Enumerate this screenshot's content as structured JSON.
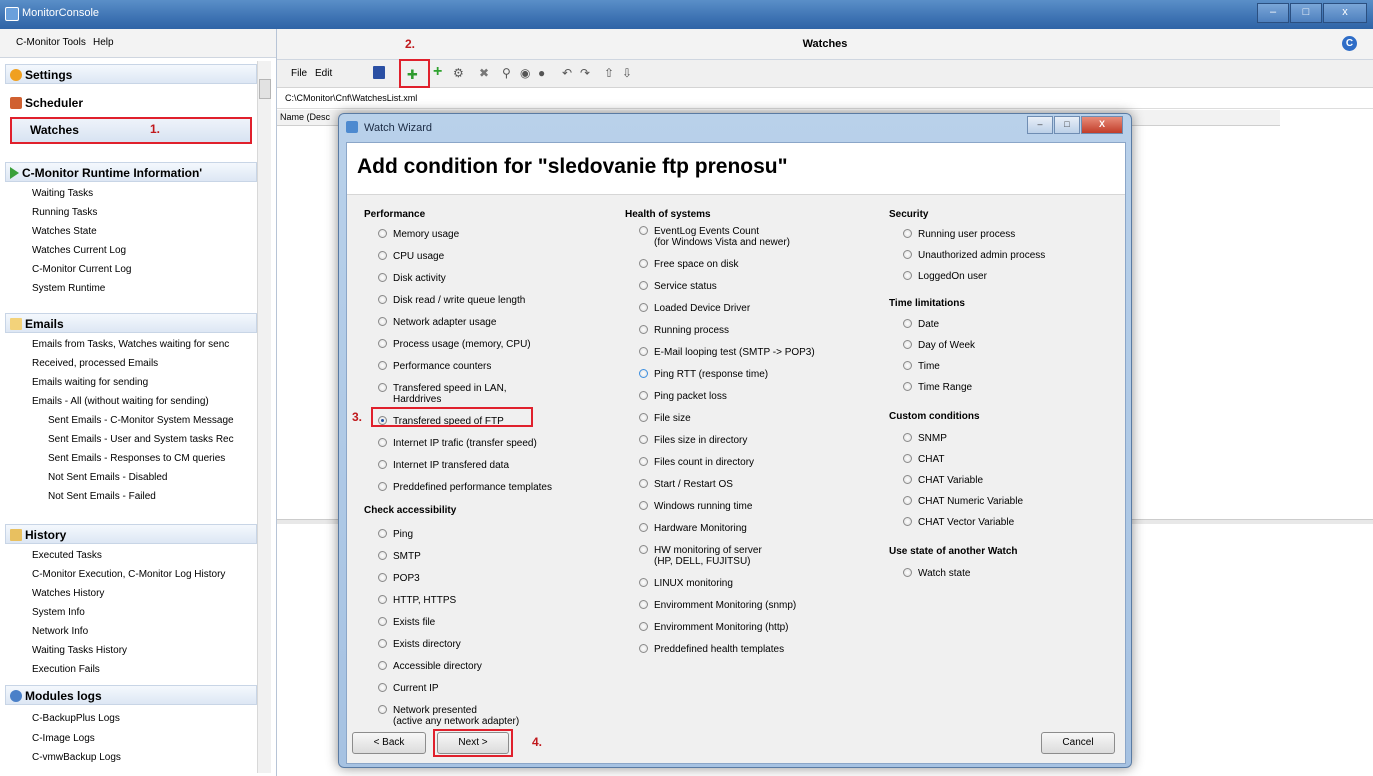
{
  "app": {
    "title": "MonitorConsole"
  },
  "window_buttons": {
    "minimize": "–",
    "maximize": "̅☐",
    "close": "x"
  },
  "left_menu": {
    "tools": "C-Monitor Tools",
    "help": "Help"
  },
  "left": {
    "settings": "Settings",
    "scheduler": "Scheduler",
    "watches": "Watches",
    "runtime": {
      "header": "C-Monitor Runtime Information'",
      "items": [
        "Waiting Tasks",
        "Running Tasks",
        "Watches State",
        "Watches Current Log",
        "C-Monitor Current Log",
        "System Runtime"
      ]
    },
    "emails": {
      "header": "Emails",
      "items": [
        "Emails from Tasks, Watches waiting for senc",
        "Received, processed Emails",
        "Emails waiting for sending",
        "Emails - All (without waiting for sending)"
      ],
      "subitems": [
        "Sent Emails - C-Monitor System Message",
        "Sent Emails - User and System tasks Rec",
        "Sent Emails - Responses to CM queries",
        "Not Sent Emails - Disabled",
        "Not Sent Emails - Failed"
      ]
    },
    "history": {
      "header": "History",
      "items": [
        "Executed Tasks",
        "C-Monitor Execution, C-Monitor Log History",
        "Watches History",
        "System Info",
        "Network Info",
        "Waiting Tasks History",
        "Execution Fails"
      ]
    },
    "modules": {
      "header": "Modules logs",
      "items": [
        "C-BackupPlus Logs",
        "C-Image Logs",
        "C-vmwBackup Logs"
      ]
    }
  },
  "right": {
    "title": "Watches",
    "logo": "C",
    "toolbar": {
      "file": "File",
      "edit": "Edit",
      "icons": [
        "save-icon",
        "new-watch-icon",
        "add-icon",
        "wizard-icon",
        "delete-icon",
        "search-icon",
        "stop-icon",
        "record-icon",
        "undo-icon",
        "redo-icon",
        "up-icon",
        "down-icon"
      ]
    },
    "path": "C:\\CMonitor\\Cnf\\WatchesList.xml",
    "grid_header": "Name (Desc"
  },
  "steps": {
    "s1": "1.",
    "s2": "2.",
    "s3": "3.",
    "s4": "4."
  },
  "dialog": {
    "title": "Watch Wizard",
    "heading": "Add condition for \"sledovanie ftp prenosu\"",
    "performance": {
      "title": "Performance",
      "options": [
        "Memory usage",
        "CPU usage",
        "Disk activity",
        "Disk read / write queue length",
        "Network adapter usage",
        "Process usage (memory, CPU)",
        "Performance counters",
        "Transfered speed in LAN,\nHarddrives",
        "Transfered speed of FTP",
        "Internet IP trafic (transfer speed)",
        "Internet IP transfered data",
        "Preddefined performance templates"
      ]
    },
    "accessibility": {
      "title": "Check accessibility",
      "options": [
        "Ping",
        "SMTP",
        "POP3",
        "HTTP, HTTPS",
        "Exists file",
        "Exists directory",
        "Accessible directory",
        "Current IP",
        "Network presented\n(active any network adapter)"
      ]
    },
    "health": {
      "title": "Health of systems",
      "options": [
        "EventLog Events Count\n(for Windows Vista and newer)",
        "Free space on disk",
        "Service status",
        "Loaded Device Driver",
        "Running process",
        "E-Mail looping test (SMTP -> POP3)",
        "Ping RTT (response time)",
        "Ping packet loss",
        "File size",
        "Files size in directory",
        "Files count in directory",
        "Start / Restart OS",
        "Windows running time",
        "Hardware Monitoring",
        "HW monitoring of server\n(HP, DELL, FUJITSU)",
        "LINUX monitoring",
        "Enviromment Monitoring (snmp)",
        "Enviromment Monitoring (http)",
        "Preddefined health templates"
      ]
    },
    "security": {
      "title": "Security",
      "options": [
        "Running user process",
        "Unauthorized admin process",
        "LoggedOn user"
      ]
    },
    "time": {
      "title": "Time limitations",
      "options": [
        "Date",
        "Day of Week",
        "Time",
        "Time Range"
      ]
    },
    "custom": {
      "title": "Custom conditions",
      "options": [
        "SNMP",
        "CHAT",
        "CHAT Variable",
        "CHAT Numeric Variable",
        "CHAT Vector Variable"
      ]
    },
    "another": {
      "title": "Use state of another Watch",
      "options": [
        "Watch state"
      ]
    },
    "buttons": {
      "back": "< Back",
      "next": "Next >",
      "cancel": "Cancel"
    }
  }
}
